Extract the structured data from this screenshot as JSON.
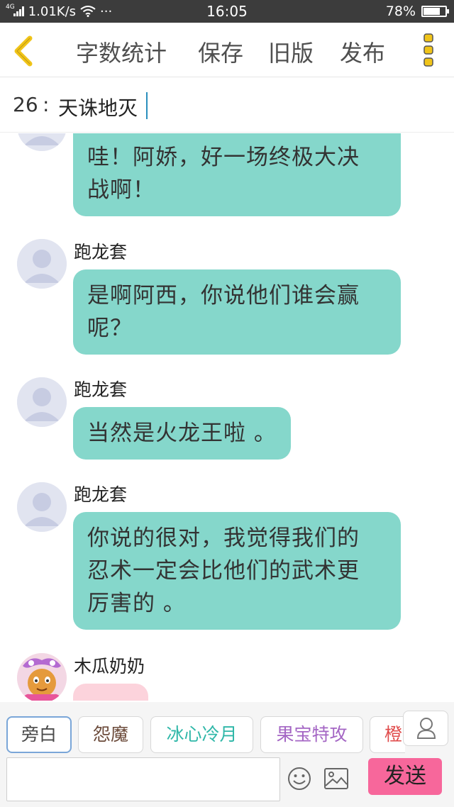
{
  "status_bar": {
    "network_type": "4G",
    "speed": "1.01K/s",
    "more": "···",
    "time": "16:05",
    "battery": "78%",
    "battery_level": 0.78
  },
  "header": {
    "buttons": {
      "word_count": "字数统计",
      "save": "保存",
      "old_version": "旧版",
      "publish": "发布"
    },
    "accent_color": "#f0c419"
  },
  "title_field": {
    "number": "26",
    "separator": ":",
    "value": "天诛地灭"
  },
  "messages": [
    {
      "speaker": "",
      "text_lines": [
        "哇！阿娇，好一场终极大决",
        "战啊！"
      ]
    },
    {
      "speaker": "跑龙套",
      "text_lines": [
        "是啊阿西，你说他们谁会赢",
        "呢？"
      ]
    },
    {
      "speaker": "跑龙套",
      "text_lines": [
        "当然是火龙王啦 。"
      ]
    },
    {
      "speaker": "跑龙套",
      "text_lines": [
        "你说的很对，我觉得我们的",
        "忍术一定会比他们的武术更",
        "厉害的 。"
      ]
    },
    {
      "speaker": "木瓜奶奶",
      "text_lines": []
    }
  ],
  "roles": [
    {
      "label": "旁白",
      "color": "#4a4a4a"
    },
    {
      "label": "怨魔",
      "color": "#6b4a3a"
    },
    {
      "label": "冰心冷月",
      "color": "#2fb7a8"
    },
    {
      "label": "果宝特攻",
      "color": "#a466c4"
    },
    {
      "label": "橙",
      "color": "#e04b4b"
    }
  ],
  "input_bar": {
    "placeholder": "",
    "send_label": "发送",
    "send_color": "#f7679b"
  },
  "bubble_color": "#85d7cb"
}
